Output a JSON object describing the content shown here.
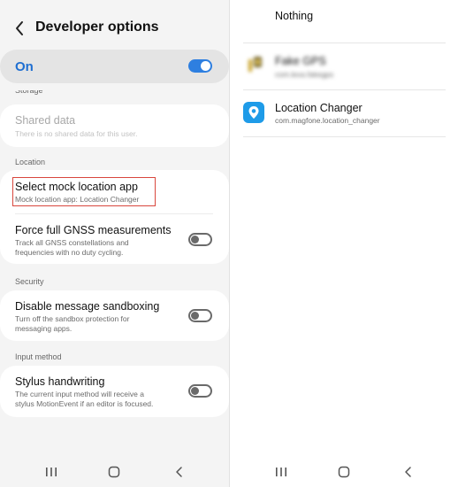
{
  "left_pane": {
    "title": "Developer options",
    "master_switch": {
      "label": "On",
      "state": "on"
    },
    "cut_section_header": "Storage",
    "shared_data": {
      "title": "Shared data",
      "subtitle": "There is no shared data for this user."
    },
    "sections": {
      "location": "Location",
      "security": "Security",
      "input_method": "Input method"
    },
    "mock_location": {
      "title": "Select mock location app",
      "subtitle": "Mock location app: Location Changer"
    },
    "gnss": {
      "title": "Force full GNSS measurements",
      "subtitle_line1": "Track all GNSS constellations and",
      "subtitle_line2": "frequencies with no duty cycling.",
      "state": "off"
    },
    "sandbox": {
      "title": "Disable message sandboxing",
      "subtitle_line1": "Turn off the sandbox protection for",
      "subtitle_line2": "messaging apps.",
      "state": "off"
    },
    "stylus": {
      "title": "Stylus handwriting",
      "subtitle_line1": "The current input method will receive a",
      "subtitle_line2": "stylus MotionEvent if an editor is focused.",
      "state": "off"
    }
  },
  "right_pane": {
    "apps": [
      {
        "name": "Nothing",
        "package": ""
      },
      {
        "name": "Fake GPS",
        "package": "com.lexa.fakegps",
        "blurred": true
      },
      {
        "name": "Location Changer",
        "package": "com.magfone.location_changer"
      }
    ]
  },
  "icons": {
    "back": "chevron-left-icon",
    "nav_recents": "recents-icon",
    "nav_home": "home-icon",
    "nav_back": "back-icon",
    "location_changer": "location-pin-app-icon"
  },
  "colors": {
    "accent": "#2e7fe0",
    "highlight_border": "#d9473d",
    "app_icon_bg": "#1e9be8"
  }
}
